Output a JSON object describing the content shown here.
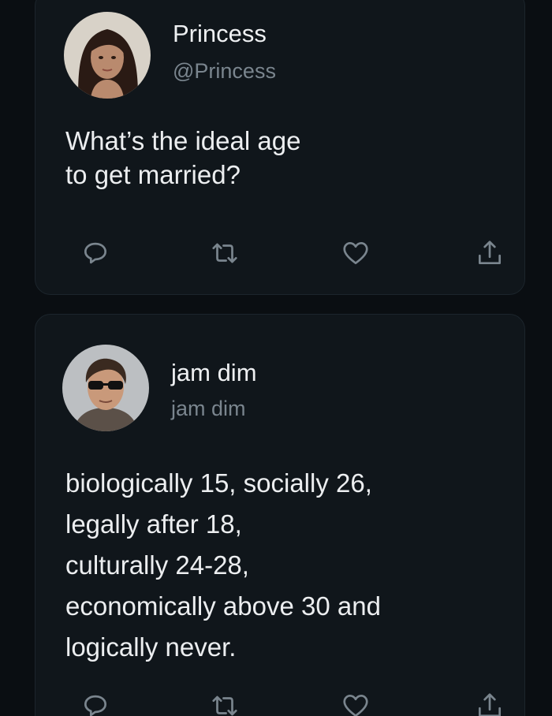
{
  "tweets": [
    {
      "name": "Princess",
      "handle": "@Princess",
      "text": "What’s the ideal age\nto get married?",
      "avatar_icon": "profile-photo-woman"
    },
    {
      "name": "jam dim",
      "handle": "jam dim",
      "text": "biologically 15, socially 26,\nlegally after 18,\nculturally 24-28,\neconomically above 30 and\nlogically never.",
      "avatar_icon": "profile-photo-man-sunglasses"
    }
  ],
  "action_icons": [
    "reply-icon",
    "retweet-icon",
    "like-icon",
    "share-icon"
  ],
  "colors": {
    "background": "#0a0e12",
    "card": "#10161b",
    "text": "#eceef0",
    "secondary": "#7a858e"
  }
}
